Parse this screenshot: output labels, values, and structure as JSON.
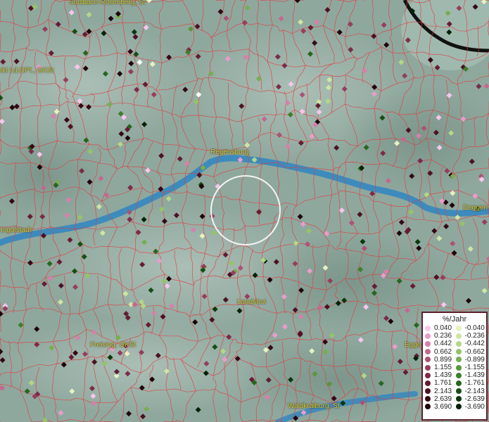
{
  "map": {
    "cities": [
      {
        "name": "Sulzbach-Rosenberg, St",
        "id": "sulzbach"
      },
      {
        "name": "rkt i.d.OPf., GKSt",
        "id": "markt"
      },
      {
        "name": "Regensburg",
        "id": "regensburg"
      },
      {
        "name": "Ingolstadt",
        "id": "ingolstadt"
      },
      {
        "name": "Deggen",
        "id": "deggendorf"
      },
      {
        "name": "Landshut",
        "id": "landshut"
      },
      {
        "name": "Freising, GKSt",
        "id": "freising"
      },
      {
        "name": "Egge",
        "id": "eggenfelden"
      },
      {
        "name": "Waldkraiburg, St",
        "id": "waldkraiburg"
      }
    ]
  },
  "legend": {
    "title": "%/Jahr",
    "positive": [
      {
        "label": "0.040",
        "color": "#f6c6ec"
      },
      {
        "label": "0.236",
        "color": "#e99ccb"
      },
      {
        "label": "0.442",
        "color": "#d680ac"
      },
      {
        "label": "0.662",
        "color": "#c46890"
      },
      {
        "label": "0.899",
        "color": "#ad5276"
      },
      {
        "label": "1.155",
        "color": "#953e5e"
      },
      {
        "label": "1.439",
        "color": "#7c2b48"
      },
      {
        "label": "1.761",
        "color": "#641c34"
      },
      {
        "label": "2.143",
        "color": "#4c1124"
      },
      {
        "label": "2.639",
        "color": "#350816"
      },
      {
        "label": "3.690",
        "color": "#1e020a"
      }
    ],
    "negative": [
      {
        "label": "-0.040",
        "color": "#e6f2c0"
      },
      {
        "label": "-0.236",
        "color": "#cfe6a2"
      },
      {
        "label": "-0.442",
        "color": "#b4d785"
      },
      {
        "label": "-0.662",
        "color": "#95c467"
      },
      {
        "label": "-0.899",
        "color": "#77ae4f"
      },
      {
        "label": "-1.155",
        "color": "#5a963b"
      },
      {
        "label": "-1.439",
        "color": "#3f7e2b"
      },
      {
        "label": "-1.761",
        "color": "#28661e"
      },
      {
        "label": "-2.143",
        "color": "#164e14"
      },
      {
        "label": "-2.639",
        "color": "#0a380c"
      },
      {
        "label": "-3.690",
        "color": "#032206"
      }
    ]
  }
}
